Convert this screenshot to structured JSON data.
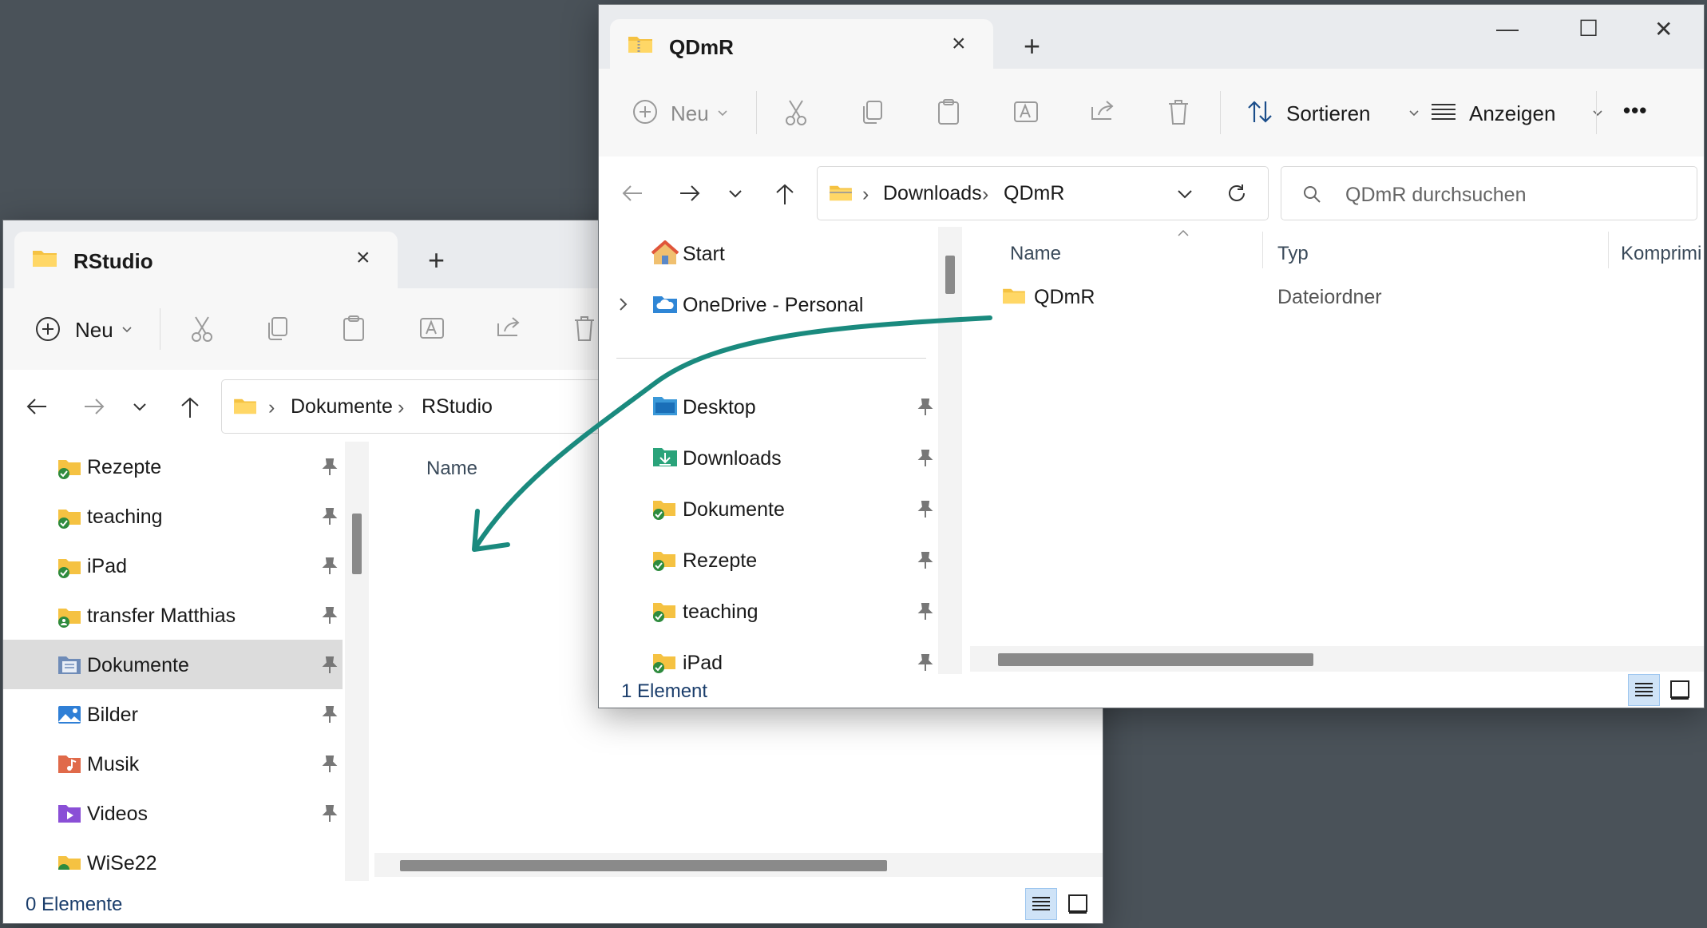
{
  "colors": {
    "desktop": "#4a5259",
    "accent": "#1a8a7e",
    "folder": "#f5c242",
    "sync_check": "#2e8b3e"
  },
  "left_window": {
    "tab_title": "RStudio",
    "tab_close_icon": "×",
    "tab_add_icon": "+",
    "toolbar": {
      "new_label": "Neu"
    },
    "breadcrumb": [
      "Dokumente",
      "RStudio"
    ],
    "sidebar": [
      {
        "label": "Rezepte",
        "icon": "folder-synced-icon"
      },
      {
        "label": "teaching",
        "icon": "folder-synced-icon"
      },
      {
        "label": "iPad",
        "icon": "folder-synced-icon"
      },
      {
        "label": "transfer Matthias",
        "icon": "folder-shared-icon"
      },
      {
        "label": "Dokumente",
        "icon": "documents-icon",
        "selected": true
      },
      {
        "label": "Bilder",
        "icon": "pictures-icon"
      },
      {
        "label": "Musik",
        "icon": "music-icon"
      },
      {
        "label": "Videos",
        "icon": "videos-icon"
      },
      {
        "label": "WiSe22",
        "icon": "folder-synced-icon"
      }
    ],
    "column_name": "Name",
    "status": "0 Elemente"
  },
  "right_window": {
    "tab_title": "QDmR",
    "tab_close_icon": "×",
    "tab_add_icon": "+",
    "window_controls": {
      "minimize": "—",
      "maximize": "☐",
      "close": "✕"
    },
    "toolbar": {
      "new_label": "Neu",
      "sort_label": "Sortieren",
      "view_label": "Anzeigen",
      "more_label": "•••"
    },
    "breadcrumb": [
      "Downloads",
      "QDmR"
    ],
    "search_placeholder": "QDmR durchsuchen",
    "sidebar_top": [
      {
        "label": "Start",
        "icon": "home-icon"
      },
      {
        "label": "OneDrive - Personal",
        "icon": "onedrive-icon"
      }
    ],
    "sidebar": [
      {
        "label": "Desktop",
        "icon": "desktop-icon"
      },
      {
        "label": "Downloads",
        "icon": "downloads-icon"
      },
      {
        "label": "Dokumente",
        "icon": "folder-synced-icon"
      },
      {
        "label": "Rezepte",
        "icon": "folder-synced-icon"
      },
      {
        "label": "teaching",
        "icon": "folder-synced-icon"
      },
      {
        "label": "iPad",
        "icon": "folder-synced-icon"
      }
    ],
    "columns": [
      "Name",
      "Typ",
      "Komprimi"
    ],
    "files": [
      {
        "name": "QDmR",
        "type": "Dateiordner"
      }
    ],
    "status": "1 Element"
  }
}
